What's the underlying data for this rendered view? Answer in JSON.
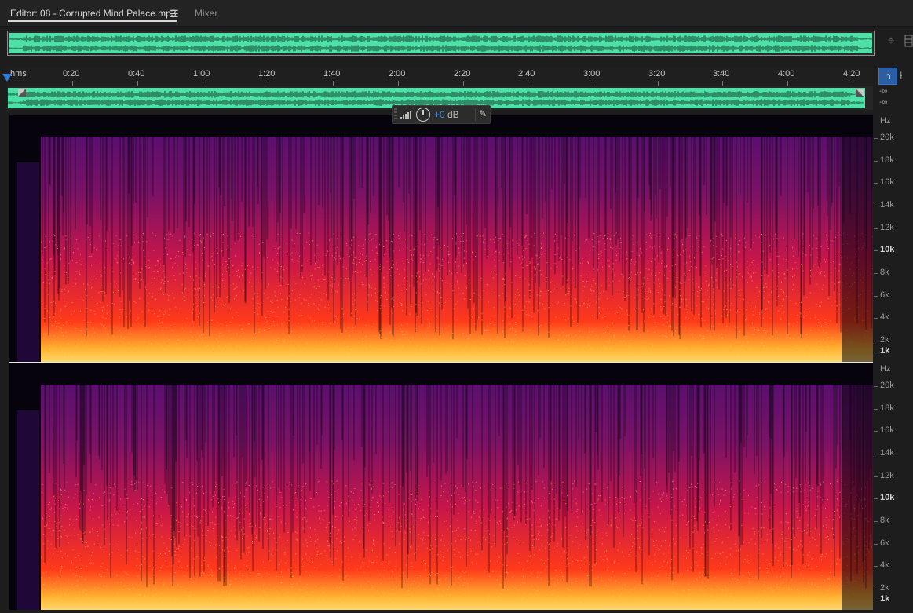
{
  "tabs": {
    "editor_label": "Editor: 08 - Corrupted Mind Palace.mp3",
    "menu_glyph": "☰",
    "mixer_label": "Mixer"
  },
  "icons": {
    "zoom": "zoom-navigator-icon",
    "snap": "snap-magnet-icon",
    "marker": "marker-pin-icon",
    "pin": "pin-icon"
  },
  "ruler": {
    "unit": "hms",
    "ticks": [
      "0:20",
      "0:40",
      "1:00",
      "1:20",
      "1:40",
      "2:00",
      "2:20",
      "2:40",
      "3:00",
      "3:20",
      "3:40",
      "4:00",
      "4:20"
    ]
  },
  "levels": {
    "left": "-∞",
    "right": "-∞"
  },
  "hud": {
    "value": "+0",
    "unit": "dB"
  },
  "freq_scale": {
    "unit": "Hz",
    "labels": [
      "20k",
      "18k",
      "16k",
      "14k",
      "12k",
      "10k",
      "8k",
      "6k",
      "4k",
      "2k",
      "1k"
    ]
  },
  "colors": {
    "waveform": "#4ee0a6",
    "accent": "#2f7be0",
    "spectrogram_low": "#ffd96a",
    "spectrogram_mid": "#ff3a1a",
    "spectrogram_high": "#5a0f6e"
  }
}
